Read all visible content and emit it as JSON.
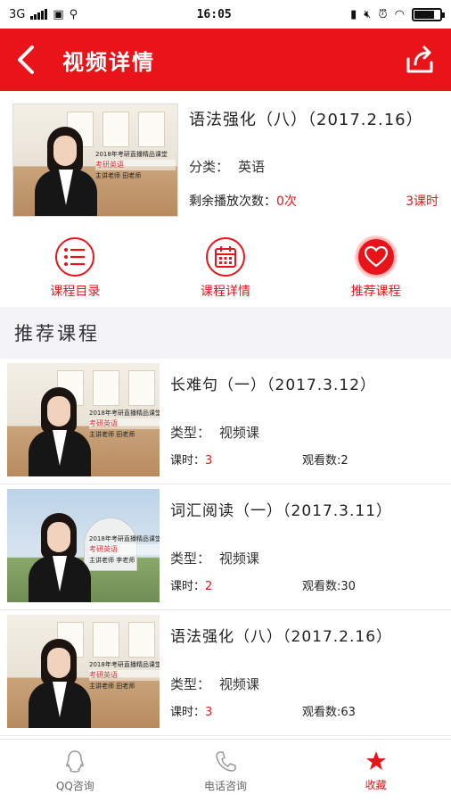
{
  "status_bar": {
    "network": "3G",
    "time": "16:05",
    "battery_level": 0.75
  },
  "header": {
    "title": "视频详情",
    "back_icon": "back-arrow-icon",
    "share_icon": "share-icon"
  },
  "colors": {
    "brand_red": "#e8141a",
    "section_bg": "#f3f3f5"
  },
  "course": {
    "title": "语法强化（八）（2017.2.16）",
    "category_label": "分类：",
    "category_value": "英语",
    "remain_label": "剩余播放次数：",
    "remain_value": "0次",
    "hours": "3课时",
    "thumb_text": {
      "line1": "2018年考研直播精品课堂",
      "line2": "考研英语",
      "line3": "主讲老师 田老师"
    }
  },
  "tabs": [
    {
      "label": "课程目录",
      "icon": "list-icon"
    },
    {
      "label": "课程详情",
      "icon": "calendar-icon"
    },
    {
      "label": "推荐课程",
      "icon": "heart-icon"
    }
  ],
  "section": {
    "title": "推荐课程"
  },
  "recommended": [
    {
      "title": "长难句（一）（2017.3.12）",
      "type_label": "类型：",
      "type_value": "视频课",
      "hours_label": "课时：",
      "hours_value": "3",
      "views_label": "观看数:",
      "views_value": "2",
      "thumb_line1": "2018年考研直播精品课堂",
      "thumb_line2": "考研英语",
      "thumb_line3": "主讲老师 田老师"
    },
    {
      "title": "词汇阅读（一）（2017.3.11）",
      "type_label": "类型：",
      "type_value": "视频课",
      "hours_label": "课时：",
      "hours_value": "2",
      "views_label": "观看数:",
      "views_value": "30",
      "thumb_line1": "2018年考研直播精品课堂",
      "thumb_line2": "考研英语",
      "thumb_line3": "主讲老师 李老师"
    },
    {
      "title": "语法强化（八）（2017.2.16）",
      "type_label": "类型：",
      "type_value": "视频课",
      "hours_label": "课时：",
      "hours_value": "3",
      "views_label": "观看数:",
      "views_value": "63",
      "thumb_line1": "2018年考研直播精品课堂",
      "thumb_line2": "考研英语",
      "thumb_line3": "主讲老师 田老师"
    }
  ],
  "bottom_nav": [
    {
      "label": "QQ咨询",
      "icon": "qq-icon"
    },
    {
      "label": "电话咨询",
      "icon": "phone-icon"
    },
    {
      "label": "收藏",
      "icon": "star-icon"
    }
  ]
}
